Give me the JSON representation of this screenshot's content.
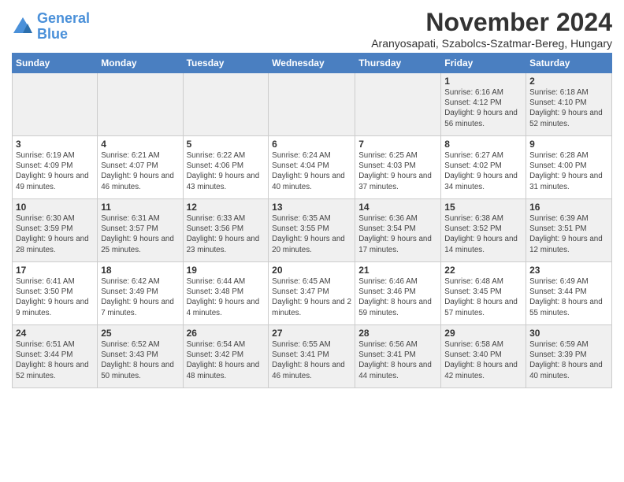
{
  "logo": {
    "line1": "General",
    "line2": "Blue"
  },
  "title": "November 2024",
  "subtitle": "Aranyosapati, Szabolcs-Szatmar-Bereg, Hungary",
  "weekdays": [
    "Sunday",
    "Monday",
    "Tuesday",
    "Wednesday",
    "Thursday",
    "Friday",
    "Saturday"
  ],
  "weeks": [
    [
      {
        "day": "",
        "info": ""
      },
      {
        "day": "",
        "info": ""
      },
      {
        "day": "",
        "info": ""
      },
      {
        "day": "",
        "info": ""
      },
      {
        "day": "",
        "info": ""
      },
      {
        "day": "1",
        "info": "Sunrise: 6:16 AM\nSunset: 4:12 PM\nDaylight: 9 hours and 56 minutes."
      },
      {
        "day": "2",
        "info": "Sunrise: 6:18 AM\nSunset: 4:10 PM\nDaylight: 9 hours and 52 minutes."
      }
    ],
    [
      {
        "day": "3",
        "info": "Sunrise: 6:19 AM\nSunset: 4:09 PM\nDaylight: 9 hours and 49 minutes."
      },
      {
        "day": "4",
        "info": "Sunrise: 6:21 AM\nSunset: 4:07 PM\nDaylight: 9 hours and 46 minutes."
      },
      {
        "day": "5",
        "info": "Sunrise: 6:22 AM\nSunset: 4:06 PM\nDaylight: 9 hours and 43 minutes."
      },
      {
        "day": "6",
        "info": "Sunrise: 6:24 AM\nSunset: 4:04 PM\nDaylight: 9 hours and 40 minutes."
      },
      {
        "day": "7",
        "info": "Sunrise: 6:25 AM\nSunset: 4:03 PM\nDaylight: 9 hours and 37 minutes."
      },
      {
        "day": "8",
        "info": "Sunrise: 6:27 AM\nSunset: 4:02 PM\nDaylight: 9 hours and 34 minutes."
      },
      {
        "day": "9",
        "info": "Sunrise: 6:28 AM\nSunset: 4:00 PM\nDaylight: 9 hours and 31 minutes."
      }
    ],
    [
      {
        "day": "10",
        "info": "Sunrise: 6:30 AM\nSunset: 3:59 PM\nDaylight: 9 hours and 28 minutes."
      },
      {
        "day": "11",
        "info": "Sunrise: 6:31 AM\nSunset: 3:57 PM\nDaylight: 9 hours and 25 minutes."
      },
      {
        "day": "12",
        "info": "Sunrise: 6:33 AM\nSunset: 3:56 PM\nDaylight: 9 hours and 23 minutes."
      },
      {
        "day": "13",
        "info": "Sunrise: 6:35 AM\nSunset: 3:55 PM\nDaylight: 9 hours and 20 minutes."
      },
      {
        "day": "14",
        "info": "Sunrise: 6:36 AM\nSunset: 3:54 PM\nDaylight: 9 hours and 17 minutes."
      },
      {
        "day": "15",
        "info": "Sunrise: 6:38 AM\nSunset: 3:52 PM\nDaylight: 9 hours and 14 minutes."
      },
      {
        "day": "16",
        "info": "Sunrise: 6:39 AM\nSunset: 3:51 PM\nDaylight: 9 hours and 12 minutes."
      }
    ],
    [
      {
        "day": "17",
        "info": "Sunrise: 6:41 AM\nSunset: 3:50 PM\nDaylight: 9 hours and 9 minutes."
      },
      {
        "day": "18",
        "info": "Sunrise: 6:42 AM\nSunset: 3:49 PM\nDaylight: 9 hours and 7 minutes."
      },
      {
        "day": "19",
        "info": "Sunrise: 6:44 AM\nSunset: 3:48 PM\nDaylight: 9 hours and 4 minutes."
      },
      {
        "day": "20",
        "info": "Sunrise: 6:45 AM\nSunset: 3:47 PM\nDaylight: 9 hours and 2 minutes."
      },
      {
        "day": "21",
        "info": "Sunrise: 6:46 AM\nSunset: 3:46 PM\nDaylight: 8 hours and 59 minutes."
      },
      {
        "day": "22",
        "info": "Sunrise: 6:48 AM\nSunset: 3:45 PM\nDaylight: 8 hours and 57 minutes."
      },
      {
        "day": "23",
        "info": "Sunrise: 6:49 AM\nSunset: 3:44 PM\nDaylight: 8 hours and 55 minutes."
      }
    ],
    [
      {
        "day": "24",
        "info": "Sunrise: 6:51 AM\nSunset: 3:44 PM\nDaylight: 8 hours and 52 minutes."
      },
      {
        "day": "25",
        "info": "Sunrise: 6:52 AM\nSunset: 3:43 PM\nDaylight: 8 hours and 50 minutes."
      },
      {
        "day": "26",
        "info": "Sunrise: 6:54 AM\nSunset: 3:42 PM\nDaylight: 8 hours and 48 minutes."
      },
      {
        "day": "27",
        "info": "Sunrise: 6:55 AM\nSunset: 3:41 PM\nDaylight: 8 hours and 46 minutes."
      },
      {
        "day": "28",
        "info": "Sunrise: 6:56 AM\nSunset: 3:41 PM\nDaylight: 8 hours and 44 minutes."
      },
      {
        "day": "29",
        "info": "Sunrise: 6:58 AM\nSunset: 3:40 PM\nDaylight: 8 hours and 42 minutes."
      },
      {
        "day": "30",
        "info": "Sunrise: 6:59 AM\nSunset: 3:39 PM\nDaylight: 8 hours and 40 minutes."
      }
    ]
  ]
}
